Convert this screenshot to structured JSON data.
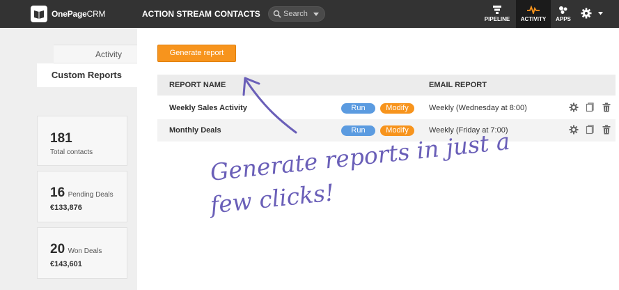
{
  "app": {
    "logo_name": "OnePage",
    "logo_suffix": "CRM"
  },
  "nav": {
    "action_stream": "ACTION STREAM",
    "contacts": "CONTACTS",
    "search_placeholder": "Search"
  },
  "top_right": {
    "pipeline": "PIPELINE",
    "activity": "ACTIVITY",
    "apps": "APPS"
  },
  "sidebar": {
    "tabs": [
      {
        "label": "Activity",
        "active": false
      },
      {
        "label": "Custom Reports",
        "active": true
      }
    ],
    "stats": [
      {
        "value": "181",
        "label": "Total contacts"
      },
      {
        "value": "16",
        "label": "Pending Deals",
        "amount": "€133,876"
      },
      {
        "value": "20",
        "label": "Won Deals",
        "amount": "€143,601"
      }
    ]
  },
  "main": {
    "generate_button": "Generate report",
    "table": {
      "headers": {
        "name": "REPORT NAME",
        "email": "EMAIL REPORT"
      },
      "rows": [
        {
          "name": "Weekly Sales Activity",
          "run": "Run",
          "modify": "Modify",
          "email": "Weekly (Wednesday at 8:00)"
        },
        {
          "name": "Monthly Deals",
          "run": "Run",
          "modify": "Modify",
          "email": "Weekly (Friday at 7:00)"
        }
      ]
    }
  },
  "annotation": {
    "line1": "Generate reports in just a",
    "line2": "few clicks!"
  },
  "colors": {
    "topbar": "#333333",
    "accent_orange": "#f7941d",
    "run_blue": "#5b9be0",
    "annotation_purple": "#6a5fb8"
  }
}
